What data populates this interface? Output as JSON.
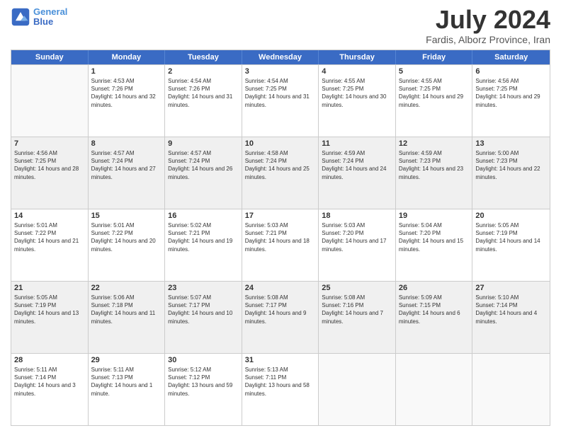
{
  "header": {
    "logo_line1": "General",
    "logo_line2": "Blue",
    "month_year": "July 2024",
    "location": "Fardis, Alborz Province, Iran"
  },
  "days_of_week": [
    "Sunday",
    "Monday",
    "Tuesday",
    "Wednesday",
    "Thursday",
    "Friday",
    "Saturday"
  ],
  "weeks": [
    [
      {
        "day": "",
        "sunrise": "",
        "sunset": "",
        "daylight": "",
        "shaded": false,
        "empty": true
      },
      {
        "day": "1",
        "sunrise": "Sunrise: 4:53 AM",
        "sunset": "Sunset: 7:26 PM",
        "daylight": "Daylight: 14 hours and 32 minutes.",
        "shaded": false,
        "empty": false
      },
      {
        "day": "2",
        "sunrise": "Sunrise: 4:54 AM",
        "sunset": "Sunset: 7:26 PM",
        "daylight": "Daylight: 14 hours and 31 minutes.",
        "shaded": false,
        "empty": false
      },
      {
        "day": "3",
        "sunrise": "Sunrise: 4:54 AM",
        "sunset": "Sunset: 7:25 PM",
        "daylight": "Daylight: 14 hours and 31 minutes.",
        "shaded": false,
        "empty": false
      },
      {
        "day": "4",
        "sunrise": "Sunrise: 4:55 AM",
        "sunset": "Sunset: 7:25 PM",
        "daylight": "Daylight: 14 hours and 30 minutes.",
        "shaded": false,
        "empty": false
      },
      {
        "day": "5",
        "sunrise": "Sunrise: 4:55 AM",
        "sunset": "Sunset: 7:25 PM",
        "daylight": "Daylight: 14 hours and 29 minutes.",
        "shaded": false,
        "empty": false
      },
      {
        "day": "6",
        "sunrise": "Sunrise: 4:56 AM",
        "sunset": "Sunset: 7:25 PM",
        "daylight": "Daylight: 14 hours and 29 minutes.",
        "shaded": false,
        "empty": false
      }
    ],
    [
      {
        "day": "7",
        "sunrise": "Sunrise: 4:56 AM",
        "sunset": "Sunset: 7:25 PM",
        "daylight": "Daylight: 14 hours and 28 minutes.",
        "shaded": true,
        "empty": false
      },
      {
        "day": "8",
        "sunrise": "Sunrise: 4:57 AM",
        "sunset": "Sunset: 7:24 PM",
        "daylight": "Daylight: 14 hours and 27 minutes.",
        "shaded": true,
        "empty": false
      },
      {
        "day": "9",
        "sunrise": "Sunrise: 4:57 AM",
        "sunset": "Sunset: 7:24 PM",
        "daylight": "Daylight: 14 hours and 26 minutes.",
        "shaded": true,
        "empty": false
      },
      {
        "day": "10",
        "sunrise": "Sunrise: 4:58 AM",
        "sunset": "Sunset: 7:24 PM",
        "daylight": "Daylight: 14 hours and 25 minutes.",
        "shaded": true,
        "empty": false
      },
      {
        "day": "11",
        "sunrise": "Sunrise: 4:59 AM",
        "sunset": "Sunset: 7:24 PM",
        "daylight": "Daylight: 14 hours and 24 minutes.",
        "shaded": true,
        "empty": false
      },
      {
        "day": "12",
        "sunrise": "Sunrise: 4:59 AM",
        "sunset": "Sunset: 7:23 PM",
        "daylight": "Daylight: 14 hours and 23 minutes.",
        "shaded": true,
        "empty": false
      },
      {
        "day": "13",
        "sunrise": "Sunrise: 5:00 AM",
        "sunset": "Sunset: 7:23 PM",
        "daylight": "Daylight: 14 hours and 22 minutes.",
        "shaded": true,
        "empty": false
      }
    ],
    [
      {
        "day": "14",
        "sunrise": "Sunrise: 5:01 AM",
        "sunset": "Sunset: 7:22 PM",
        "daylight": "Daylight: 14 hours and 21 minutes.",
        "shaded": false,
        "empty": false
      },
      {
        "day": "15",
        "sunrise": "Sunrise: 5:01 AM",
        "sunset": "Sunset: 7:22 PM",
        "daylight": "Daylight: 14 hours and 20 minutes.",
        "shaded": false,
        "empty": false
      },
      {
        "day": "16",
        "sunrise": "Sunrise: 5:02 AM",
        "sunset": "Sunset: 7:21 PM",
        "daylight": "Daylight: 14 hours and 19 minutes.",
        "shaded": false,
        "empty": false
      },
      {
        "day": "17",
        "sunrise": "Sunrise: 5:03 AM",
        "sunset": "Sunset: 7:21 PM",
        "daylight": "Daylight: 14 hours and 18 minutes.",
        "shaded": false,
        "empty": false
      },
      {
        "day": "18",
        "sunrise": "Sunrise: 5:03 AM",
        "sunset": "Sunset: 7:20 PM",
        "daylight": "Daylight: 14 hours and 17 minutes.",
        "shaded": false,
        "empty": false
      },
      {
        "day": "19",
        "sunrise": "Sunrise: 5:04 AM",
        "sunset": "Sunset: 7:20 PM",
        "daylight": "Daylight: 14 hours and 15 minutes.",
        "shaded": false,
        "empty": false
      },
      {
        "day": "20",
        "sunrise": "Sunrise: 5:05 AM",
        "sunset": "Sunset: 7:19 PM",
        "daylight": "Daylight: 14 hours and 14 minutes.",
        "shaded": false,
        "empty": false
      }
    ],
    [
      {
        "day": "21",
        "sunrise": "Sunrise: 5:05 AM",
        "sunset": "Sunset: 7:19 PM",
        "daylight": "Daylight: 14 hours and 13 minutes.",
        "shaded": true,
        "empty": false
      },
      {
        "day": "22",
        "sunrise": "Sunrise: 5:06 AM",
        "sunset": "Sunset: 7:18 PM",
        "daylight": "Daylight: 14 hours and 11 minutes.",
        "shaded": true,
        "empty": false
      },
      {
        "day": "23",
        "sunrise": "Sunrise: 5:07 AM",
        "sunset": "Sunset: 7:17 PM",
        "daylight": "Daylight: 14 hours and 10 minutes.",
        "shaded": true,
        "empty": false
      },
      {
        "day": "24",
        "sunrise": "Sunrise: 5:08 AM",
        "sunset": "Sunset: 7:17 PM",
        "daylight": "Daylight: 14 hours and 9 minutes.",
        "shaded": true,
        "empty": false
      },
      {
        "day": "25",
        "sunrise": "Sunrise: 5:08 AM",
        "sunset": "Sunset: 7:16 PM",
        "daylight": "Daylight: 14 hours and 7 minutes.",
        "shaded": true,
        "empty": false
      },
      {
        "day": "26",
        "sunrise": "Sunrise: 5:09 AM",
        "sunset": "Sunset: 7:15 PM",
        "daylight": "Daylight: 14 hours and 6 minutes.",
        "shaded": true,
        "empty": false
      },
      {
        "day": "27",
        "sunrise": "Sunrise: 5:10 AM",
        "sunset": "Sunset: 7:14 PM",
        "daylight": "Daylight: 14 hours and 4 minutes.",
        "shaded": true,
        "empty": false
      }
    ],
    [
      {
        "day": "28",
        "sunrise": "Sunrise: 5:11 AM",
        "sunset": "Sunset: 7:14 PM",
        "daylight": "Daylight: 14 hours and 3 minutes.",
        "shaded": false,
        "empty": false
      },
      {
        "day": "29",
        "sunrise": "Sunrise: 5:11 AM",
        "sunset": "Sunset: 7:13 PM",
        "daylight": "Daylight: 14 hours and 1 minute.",
        "shaded": false,
        "empty": false
      },
      {
        "day": "30",
        "sunrise": "Sunrise: 5:12 AM",
        "sunset": "Sunset: 7:12 PM",
        "daylight": "Daylight: 13 hours and 59 minutes.",
        "shaded": false,
        "empty": false
      },
      {
        "day": "31",
        "sunrise": "Sunrise: 5:13 AM",
        "sunset": "Sunset: 7:11 PM",
        "daylight": "Daylight: 13 hours and 58 minutes.",
        "shaded": false,
        "empty": false
      },
      {
        "day": "",
        "sunrise": "",
        "sunset": "",
        "daylight": "",
        "shaded": false,
        "empty": true
      },
      {
        "day": "",
        "sunrise": "",
        "sunset": "",
        "daylight": "",
        "shaded": false,
        "empty": true
      },
      {
        "day": "",
        "sunrise": "",
        "sunset": "",
        "daylight": "",
        "shaded": false,
        "empty": true
      }
    ]
  ]
}
